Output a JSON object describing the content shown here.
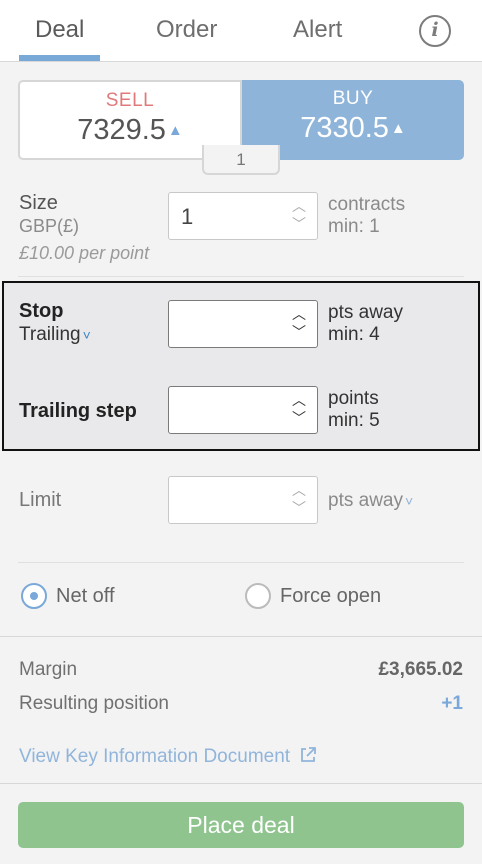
{
  "tabs": [
    {
      "label": "Deal",
      "active": true
    },
    {
      "label": "Order",
      "active": false
    },
    {
      "label": "Alert",
      "active": false
    }
  ],
  "info_icon": "i",
  "quote": {
    "sell_label": "SELL",
    "sell_price": "7329.5",
    "buy_label": "BUY",
    "buy_price": "7330.5",
    "arrow": "▲",
    "spread": "1"
  },
  "size": {
    "label": "Size",
    "currency": "GBP(£)",
    "value": "1",
    "per_point": "£10.00 per point",
    "unit": "contracts",
    "min": "min: 1"
  },
  "stop": {
    "label": "Stop",
    "type": "Trailing",
    "value": "",
    "unit": "pts away",
    "min": "min: 4"
  },
  "trailing_step": {
    "label": "Trailing step",
    "value": "",
    "unit": "points",
    "min": "min: 5"
  },
  "limit": {
    "label": "Limit",
    "value": "",
    "unit": "pts away"
  },
  "position_mode": {
    "options": [
      {
        "label": "Net off",
        "selected": true
      },
      {
        "label": "Force open",
        "selected": false
      }
    ]
  },
  "summary": {
    "margin_label": "Margin",
    "margin_value": "£3,665.02",
    "resulting_label": "Resulting position",
    "resulting_value": "+1",
    "kid_link": "View Key Information Document"
  },
  "place_deal": "Place deal",
  "colors": {
    "accent_blue": "#8fb4da",
    "sell_red": "#e07a7a",
    "place_green": "#8fc48f"
  },
  "icons": [
    "info-icon",
    "chevron-down-icon",
    "external-link-icon",
    "up-arrow-icon"
  ]
}
